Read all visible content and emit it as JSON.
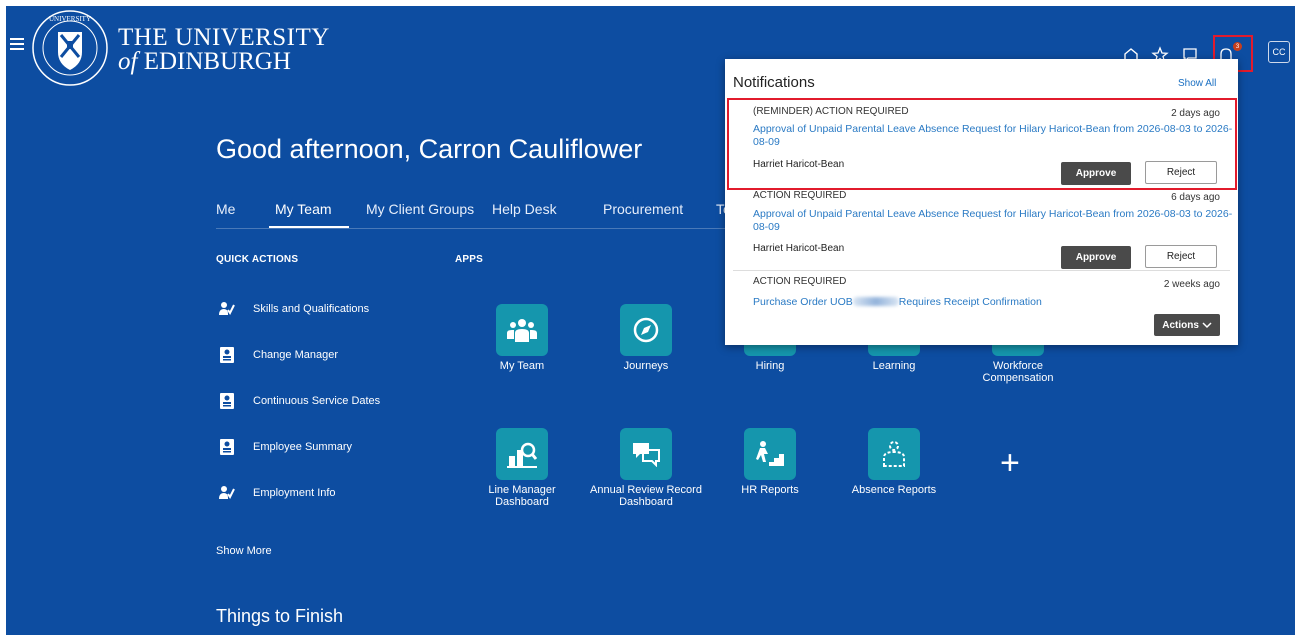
{
  "university": {
    "line1": "THE UNIVERSITY",
    "line2_prefix": "of",
    "line2_rest": " EDINBURGH"
  },
  "header": {
    "avatar_initials": "CC",
    "notification_count": "3"
  },
  "greeting": "Good afternoon, Carron Cauliflower",
  "tabs": [
    "Me",
    "My Team",
    "My Client Groups",
    "Help Desk",
    "Procurement",
    "To"
  ],
  "quick_actions": {
    "heading": "QUICK ACTIONS",
    "items": [
      "Skills and Qualifications",
      "Change Manager",
      "Continuous Service Dates",
      "Employee Summary",
      "Employment Info"
    ],
    "show_more": "Show More"
  },
  "apps": {
    "heading": "APPS",
    "row1": [
      {
        "label": "My Team",
        "icon": "team-icon"
      },
      {
        "label": "Journeys",
        "icon": "compass-icon"
      },
      {
        "label": "Hiring",
        "icon": "hiring-icon"
      },
      {
        "label": "Learning",
        "icon": "learning-icon"
      },
      {
        "label": "Workforce Compensation",
        "icon": "compensation-icon"
      }
    ],
    "row2": [
      {
        "label": "Line Manager Dashboard",
        "icon": "dashboard-icon"
      },
      {
        "label": "Annual Review Record Dashboard",
        "icon": "chat-icon"
      },
      {
        "label": "HR Reports",
        "icon": "stairs-icon"
      },
      {
        "label": "Absence Reports",
        "icon": "absence-icon"
      }
    ],
    "add_symbol": "+"
  },
  "things_to_finish": "Things to Finish",
  "notifications": {
    "title": "Notifications",
    "show_all": "Show All",
    "items": [
      {
        "type": "(REMINDER) ACTION REQUIRED",
        "time": "2 days ago",
        "message": "Approval of Unpaid Parental Leave Absence Request for Hilary Haricot-Bean from 2026-08-03 to 2026-08-09",
        "from": "Harriet Haricot-Bean",
        "approve": "Approve",
        "reject": "Reject"
      },
      {
        "type": "ACTION REQUIRED",
        "time": "6 days ago",
        "message": "Approval of Unpaid Parental Leave Absence Request for Hilary Haricot-Bean from 2026-08-03 to 2026-08-09",
        "from": "Harriet Haricot-Bean",
        "approve": "Approve",
        "reject": "Reject"
      },
      {
        "type": "ACTION REQUIRED",
        "time": "2 weeks ago",
        "message_prefix": "Purchase Order UOB",
        "message_suffix": "Requires Receipt Confirmation",
        "actions": "Actions"
      }
    ]
  },
  "colors": {
    "background": "#0d4da1",
    "tile": "#1596ad",
    "link": "#2a7ac4",
    "highlight": "#e21b2c"
  }
}
